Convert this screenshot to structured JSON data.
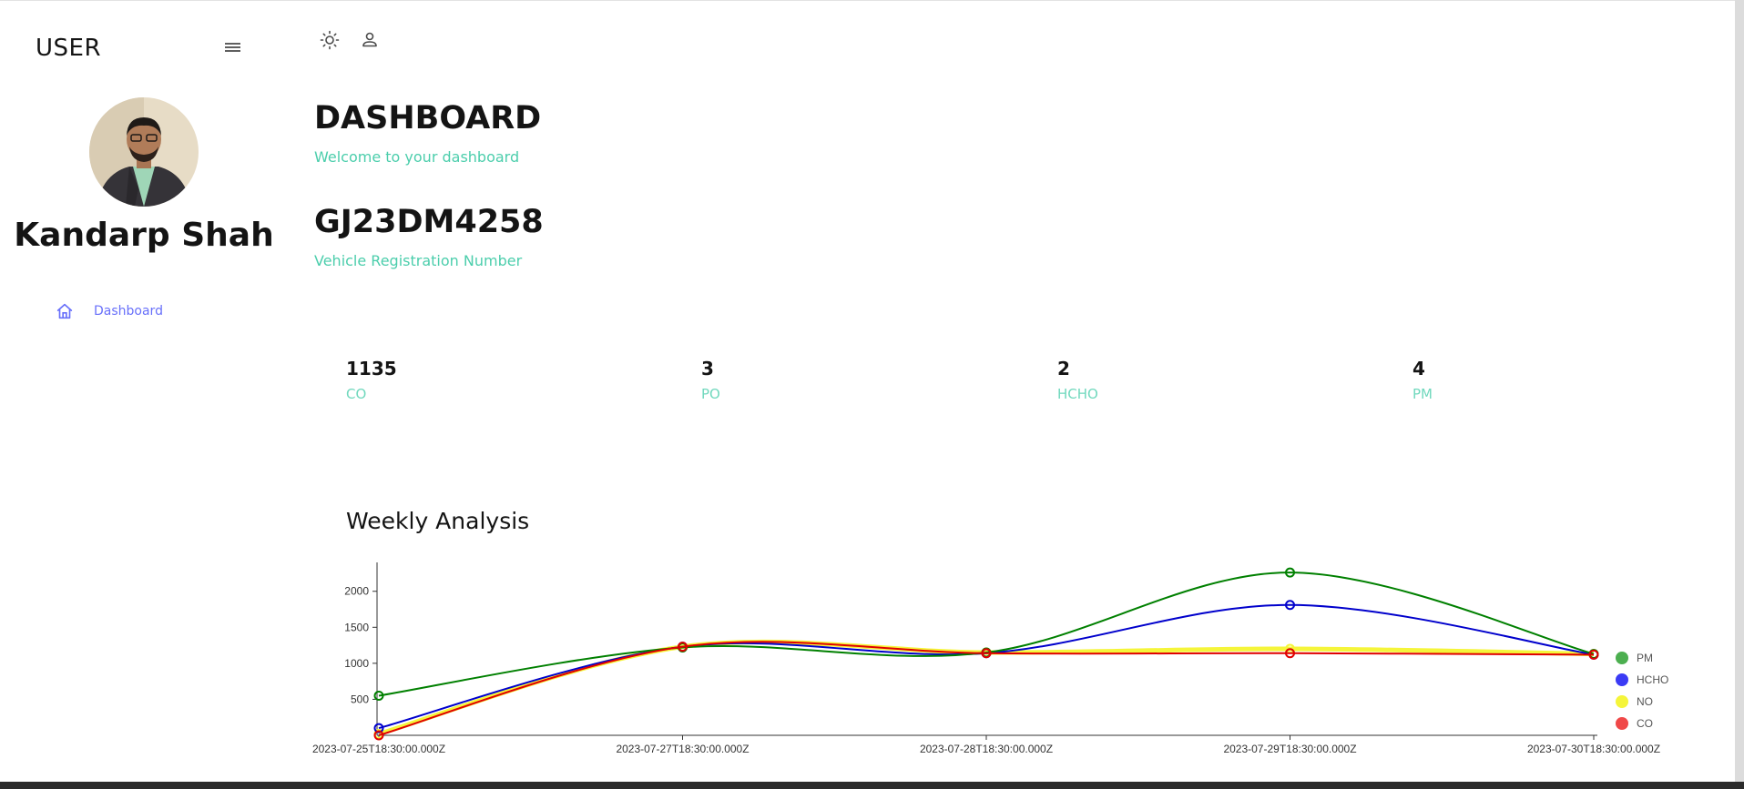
{
  "sidebar": {
    "brand": "USER",
    "user_name": "Kandarp Shah",
    "nav": [
      {
        "label": "Dashboard",
        "icon": "home-icon"
      }
    ]
  },
  "topbar": {
    "icons": [
      "light-mode-icon",
      "person-icon"
    ]
  },
  "header": {
    "title": "DASHBOARD",
    "subtitle": "Welcome to your dashboard"
  },
  "vehicle": {
    "number": "GJ23DM4258",
    "label": "Vehicle Registration Number"
  },
  "stats": [
    {
      "value": "1135",
      "label": "CO"
    },
    {
      "value": "3",
      "label": "PO"
    },
    {
      "value": "2",
      "label": "HCHO"
    },
    {
      "value": "4",
      "label": "PM"
    }
  ],
  "colors": {
    "accent_text": "#4cceac",
    "stat_label": "#70d8bd",
    "nav_active": "#6870fa"
  },
  "chart_data": {
    "type": "line",
    "title": "Weekly Analysis",
    "x": [
      "2023-07-25T18:30:00.000Z",
      "2023-07-27T18:30:00.000Z",
      "2023-07-28T18:30:00.000Z",
      "2023-07-29T18:30:00.000Z",
      "2023-07-30T18:30:00.000Z"
    ],
    "ylim": [
      0,
      2300
    ],
    "yticks": [
      "500",
      "1000",
      "1500",
      "2000"
    ],
    "legend_position": "right",
    "series": [
      {
        "name": "PM",
        "color": "#008000",
        "legend_color": "#4caf50",
        "values": [
          550,
          1220,
          1150,
          2260,
          1130
        ]
      },
      {
        "name": "HCHO",
        "color": "#0000cc",
        "legend_color": "#3b3bf5",
        "values": [
          100,
          1230,
          1140,
          1810,
          1120
        ]
      },
      {
        "name": "NO",
        "color": "#f5f53a",
        "legend_color": "#f5f53a",
        "values": [
          20,
          1230,
          1150,
          1200,
          1130
        ]
      },
      {
        "name": "CO",
        "color": "#e00000",
        "legend_color": "#f04848",
        "values": [
          0,
          1230,
          1140,
          1140,
          1120
        ]
      }
    ]
  }
}
